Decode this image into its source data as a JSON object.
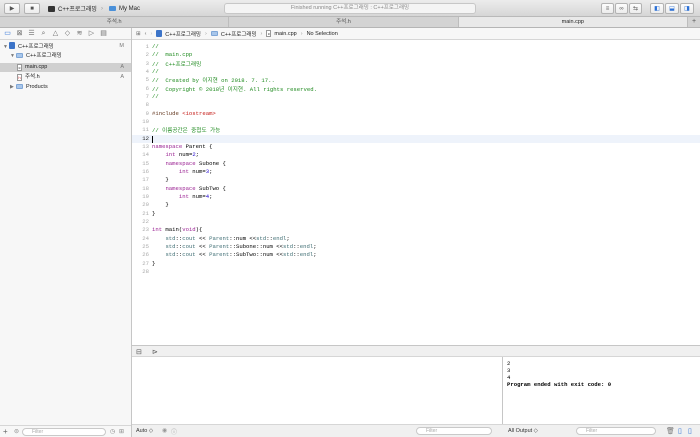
{
  "toolbar": {
    "scheme": "C++프로그래밍",
    "destination": "My Mac",
    "activity": "Finished running C++프로그래밍 : C++프로그래밍"
  },
  "tabs": [
    "주석.h",
    "주석.h",
    "main.cpp"
  ],
  "navigator": {
    "items": [
      {
        "label": "C++프로그래밍",
        "badge": "M"
      },
      {
        "label": "C++프로그래밍",
        "badge": ""
      },
      {
        "label": "main.cpp",
        "badge": "A"
      },
      {
        "label": "주석.h",
        "badge": "A"
      },
      {
        "label": "Products",
        "badge": ""
      }
    ],
    "filter_placeholder": "Filter"
  },
  "jumpbar": {
    "project": "C++프로그래밍",
    "group": "C++프로그래밍",
    "file": "main.cpp",
    "selection": "No Selection"
  },
  "code_lines": [
    "//",
    "//  main.cpp",
    "//  C++프로그래밍",
    "//",
    "//  Created by 이지현 on 2018. 7. 17..",
    "//  Copyright © 2018년 이지현. All rights reserved.",
    "//",
    "",
    "#include <iostream>",
    "",
    "// 이름공간은 중첩도 가능",
    "",
    "namespace Parent {",
    "    int num=2;",
    "    namespace Subone {",
    "        int num=3;",
    "    }",
    "    namespace SubTwo {",
    "        int num=4;",
    "    }",
    "}",
    "",
    "int main(void){",
    "    std::cout << Parent::num <<std::endl;",
    "    std::cout << Parent::Subone::num <<std::endl;",
    "    std::cout << Parent::SubTwo::num <<std::endl;",
    "}",
    ""
  ],
  "current_line": 12,
  "console": {
    "lines": [
      "2",
      "3",
      "4",
      "Program ended with exit code: 0"
    ]
  },
  "bottom": {
    "auto_label": "Auto ◇",
    "filter_placeholder": "Filter",
    "output_label": "All Output ◇",
    "console_filter_placeholder": "Filter"
  }
}
